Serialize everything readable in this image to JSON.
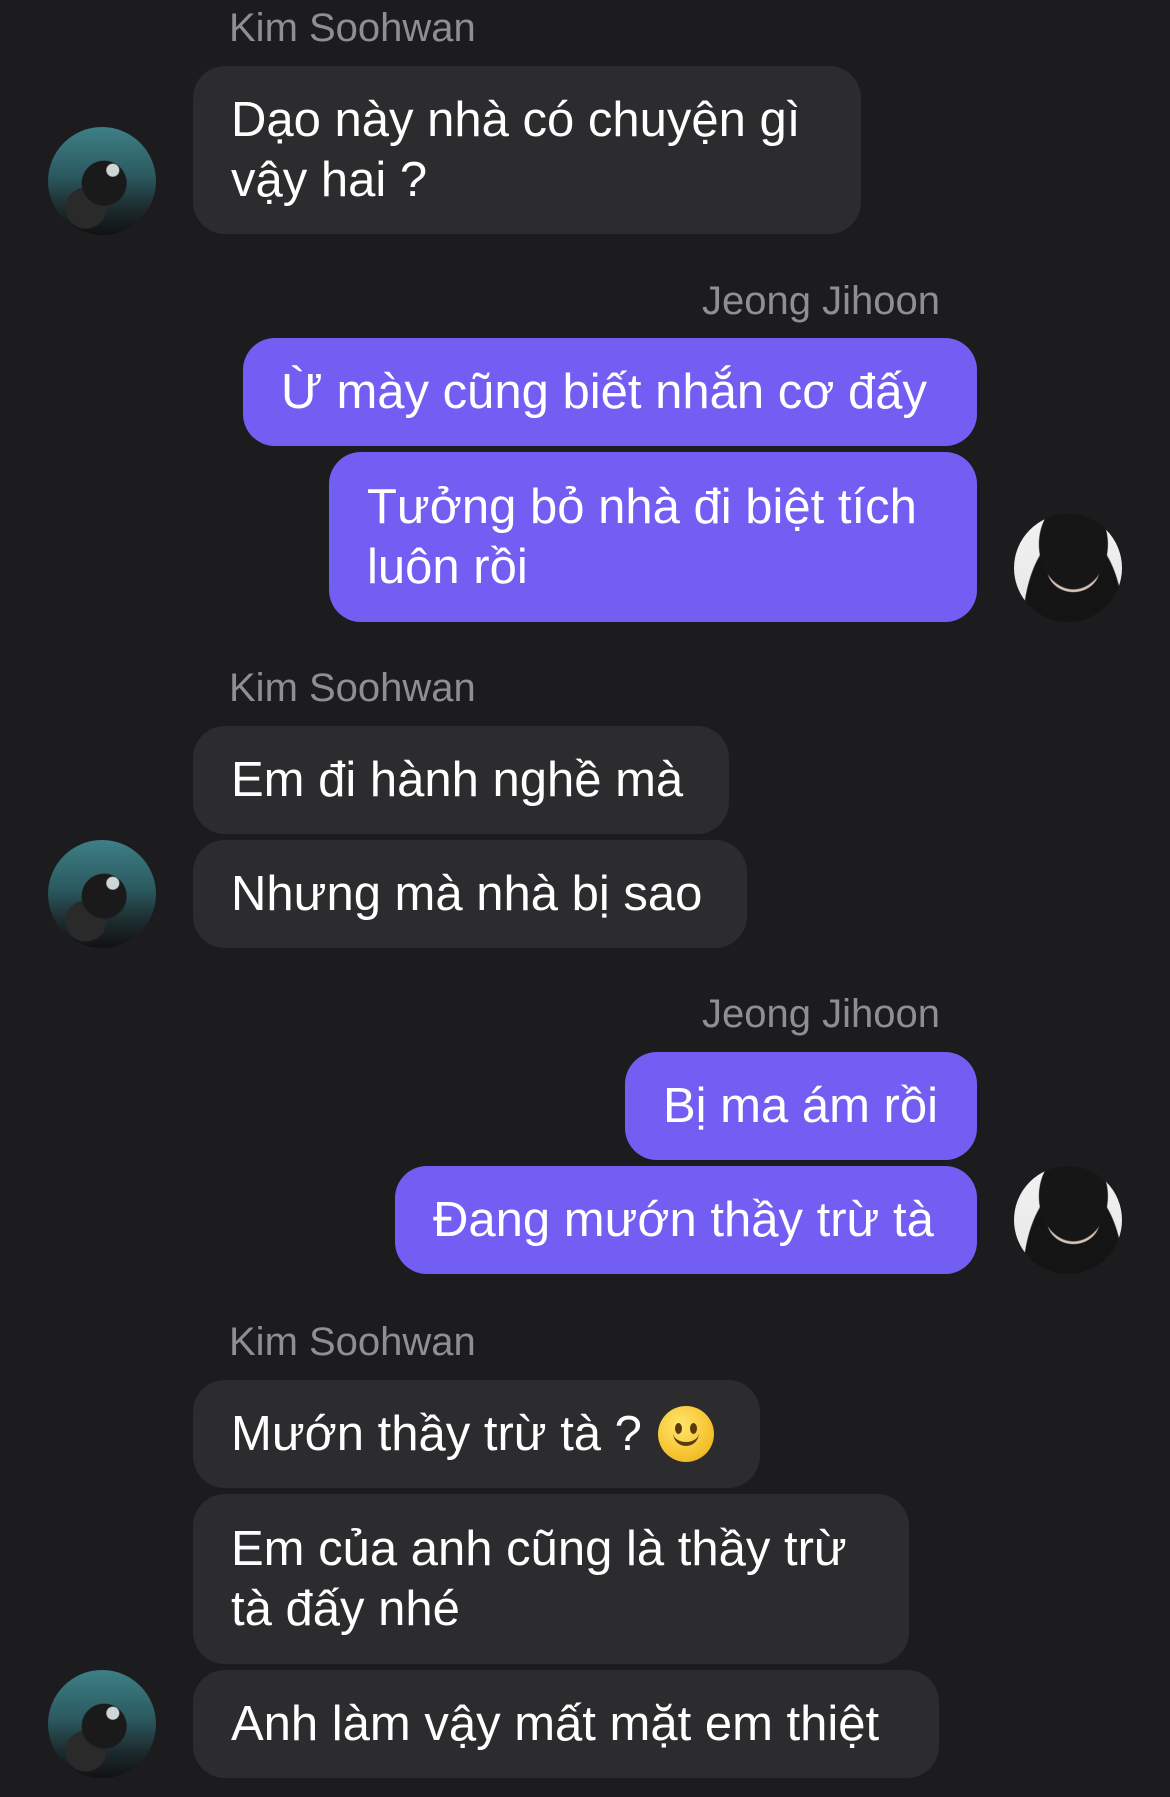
{
  "participants": {
    "kim": {
      "name": "Kim Soohwan",
      "avatar": "kim-avatar"
    },
    "jeong": {
      "name": "Jeong Jihoon",
      "avatar": "jeong-avatar"
    }
  },
  "messages": [
    {
      "sender": "Kim Soohwan",
      "text": "Dạo này nhà có chuyện gì vậy hai ?"
    },
    {
      "sender": "Jeong Jihoon",
      "text": "Ừ mày cũng biết nhắn cơ đấy"
    },
    {
      "sender": "Jeong Jihoon",
      "text": "Tưởng bỏ nhà đi biệt tích luôn rồi"
    },
    {
      "sender": "Kim Soohwan",
      "text": "Em đi hành nghề mà"
    },
    {
      "sender": "Kim Soohwan",
      "text": "Nhưng mà nhà bị sao"
    },
    {
      "sender": "Jeong Jihoon",
      "text": "Bị ma ám rồi"
    },
    {
      "sender": "Jeong Jihoon",
      "text": "Đang mướn thầy trừ tà"
    },
    {
      "sender": "Kim Soohwan",
      "text": "Mướn thầy trừ tà ?",
      "emoji": "slightly-smiling-face"
    },
    {
      "sender": "Kim Soohwan",
      "text": "Em của anh cũng là thầy trừ tà đấy nhé"
    },
    {
      "sender": "Kim Soohwan",
      "text": "Anh làm vậy mất mặt em thiệt"
    }
  ],
  "colors": {
    "background": "#1c1c1e",
    "incoming_bubble": "#2c2c2e",
    "outgoing_bubble": "#735ef3",
    "sender_name": "#8e8e93"
  }
}
